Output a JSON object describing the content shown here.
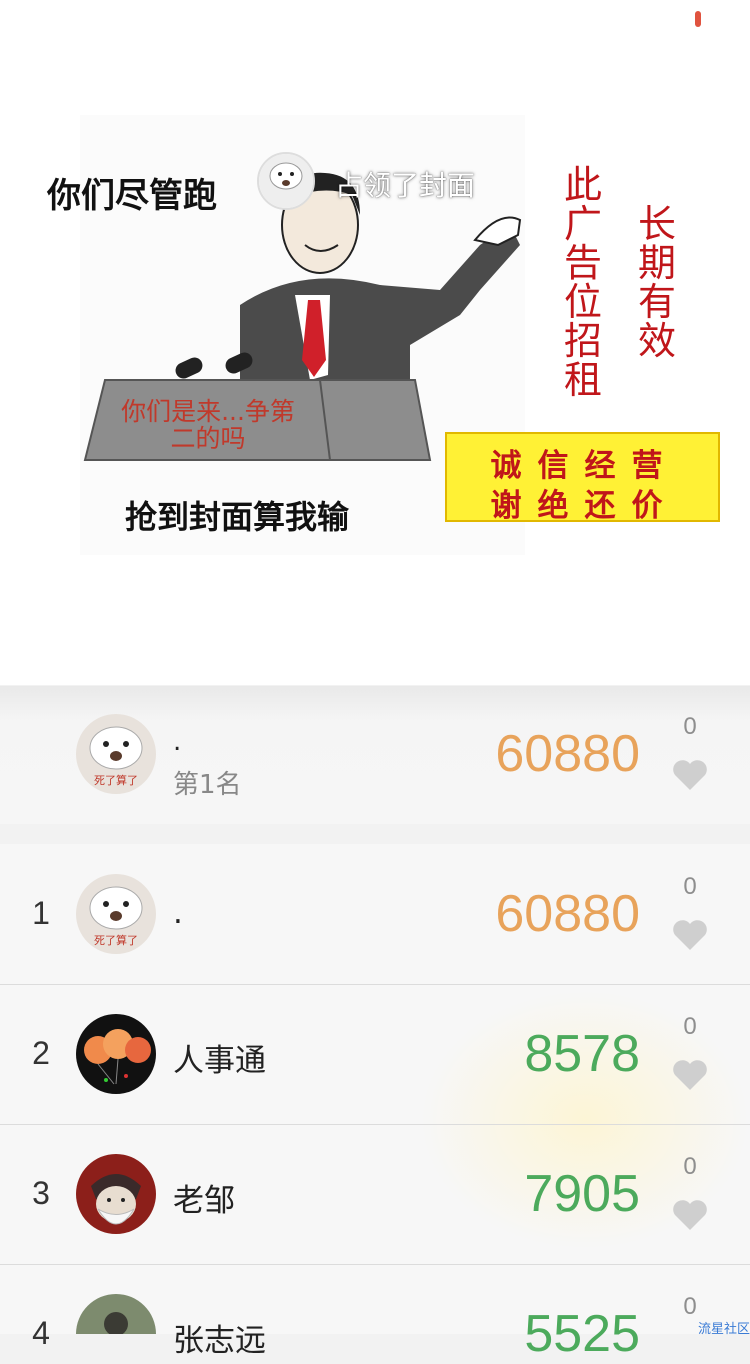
{
  "cover": {
    "caption": "占领了封面",
    "meme_top_text": "你们尽管跑",
    "meme_bottom_text": "抢到封面算我输",
    "podium_text": "你们是来...争第二的吗",
    "ad_vertical_1": "此广告位招租",
    "ad_vertical_2": "长期有效",
    "ad_box_line1": "诚信经营",
    "ad_box_line2": "谢绝还价",
    "owner_avatar_caption": "死了算了"
  },
  "my_rank": {
    "name": ".",
    "rank_label": "第1名",
    "steps": "60880",
    "likes": "0",
    "avatar_caption": "死了算了"
  },
  "leaderboard": [
    {
      "rank": "1",
      "name": ".",
      "steps": "60880",
      "likes": "0",
      "avatar_caption": "死了算了"
    },
    {
      "rank": "2",
      "name": "人事通",
      "steps": "8578",
      "likes": "0"
    },
    {
      "rank": "3",
      "name": "老邹",
      "steps": "7905",
      "likes": "0"
    },
    {
      "rank": "4",
      "name": "张志远",
      "steps": "5525",
      "likes": "0"
    }
  ],
  "watermark": "流星社区",
  "colors": {
    "steps_first": "#e8a35b",
    "steps_other": "#4caa5c",
    "heart": "#cfcfcf",
    "accent_red": "#c0161a"
  }
}
